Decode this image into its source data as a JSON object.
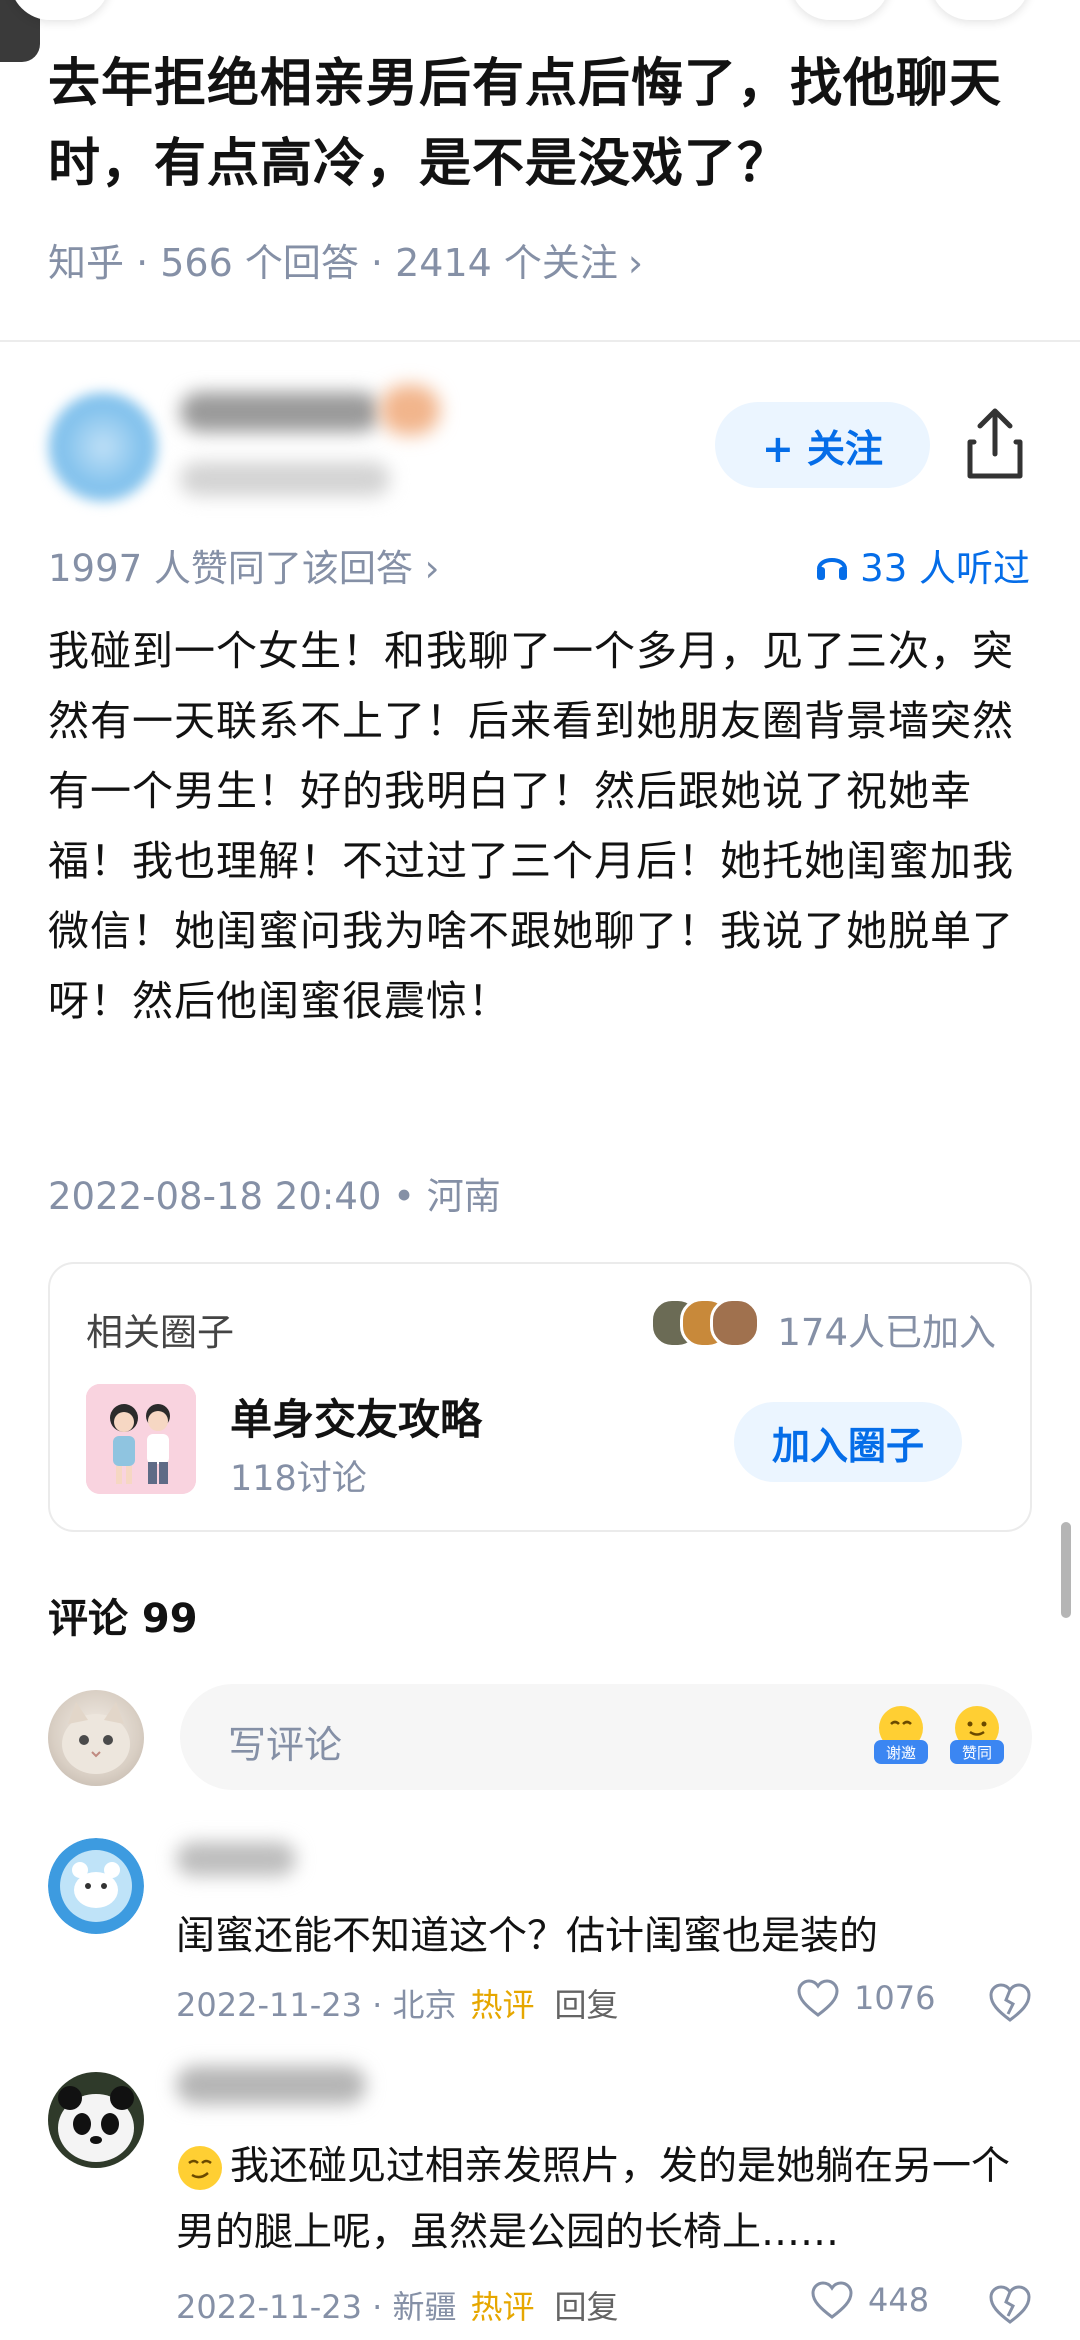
{
  "question": {
    "title": "去年拒绝相亲男后有点后悔了，找他聊天时，有点高冷，是不是没戏了？",
    "meta": "知乎 · 566 个回答 · 2414 个关注",
    "meta_chevron": "›"
  },
  "answer": {
    "follow_label": "+ 关注",
    "votes_text": "1997 人赞同了该回答 ›",
    "listen_text": "33 人听过",
    "content": "我碰到一个女生！和我聊了一个多月，见了三次，突然有一天联系不上了！后来看到她朋友圈背景墙突然有一个男生！好的我明白了！然后跟她说了祝她幸福！我也理解！不过过了三个月后！她托她闺蜜加我微信！她闺蜜问我为啥不跟她聊了！我说了她脱单了呀！然后他闺蜜很震惊！",
    "post_meta": "2022-08-18 20:40 • 河南"
  },
  "circle": {
    "label": "相关圈子",
    "joined": "174人已加入",
    "name": "单身交友攻略",
    "discussions": "118讨论",
    "join_label": "加入圈子"
  },
  "comments": {
    "title": "评论 99",
    "input_placeholder": "写评论",
    "emoji_thanks": "谢邀",
    "emoji_agree": "赞同",
    "items": [
      {
        "text": "闺蜜还能不知道这个？估计闺蜜也是装的",
        "date": "2022-11-23 · 北京",
        "hot": "热评",
        "reply": "回复",
        "likes": "1076"
      },
      {
        "text": "我还碰见过相亲发照片，发的是她躺在另一个男的腿上呢，虽然是公园的长椅上……",
        "date": "2022-11-23 · 新疆",
        "hot": "热评",
        "reply": "回复",
        "likes": "448"
      }
    ]
  },
  "colors": {
    "accent": "#056de8",
    "hot": "#e6a700",
    "muted": "#8590a6"
  }
}
